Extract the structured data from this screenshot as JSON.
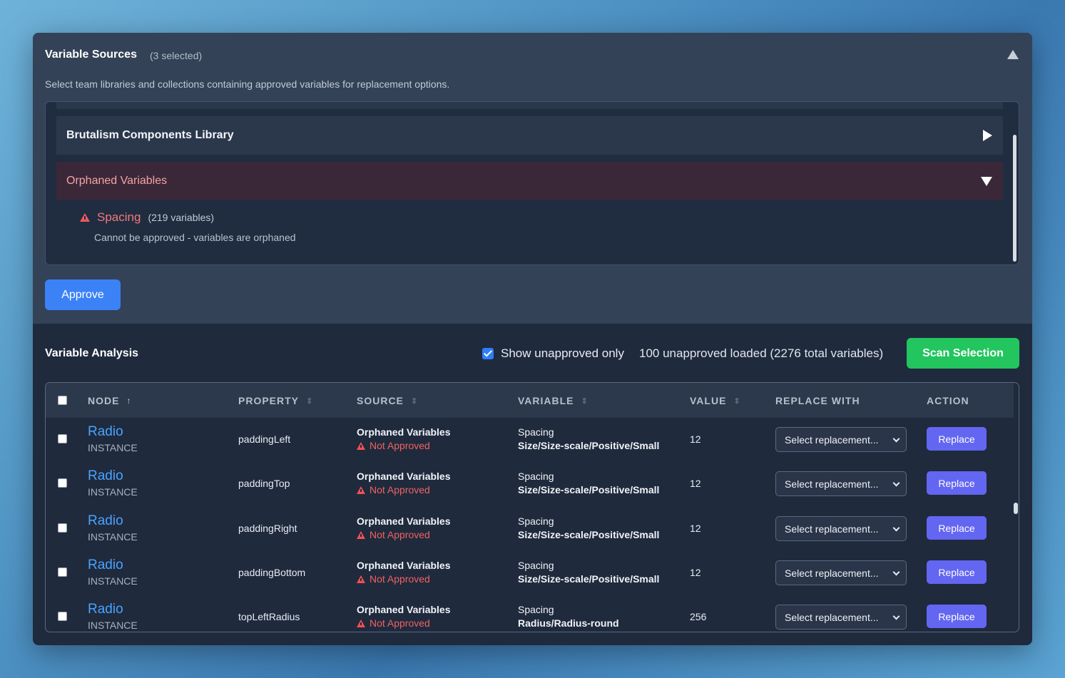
{
  "sources": {
    "title": "Variable Sources",
    "selected_count": "(3 selected)",
    "description": "Select team libraries and collections containing approved variables for replacement options.",
    "libraries": [
      {
        "name": "Brutalism Components Library",
        "expanded": false
      },
      {
        "name": "Orphaned Variables",
        "expanded": true
      }
    ],
    "orphan_item": {
      "name": "Spacing",
      "count": "(219 variables)",
      "note": "Cannot be approved - variables are orphaned"
    },
    "approve_label": "Approve"
  },
  "analysis": {
    "title": "Variable Analysis",
    "show_unapproved_label": "Show unapproved only",
    "show_unapproved_checked": true,
    "loaded_label": "100 unapproved loaded (2276 total variables)",
    "scan_label": "Scan Selection"
  },
  "table": {
    "columns": {
      "node": "NODE",
      "property": "PROPERTY",
      "source": "SOURCE",
      "variable": "VARIABLE",
      "value": "VALUE",
      "replace_with": "REPLACE WITH",
      "action": "ACTION"
    },
    "rows": [
      {
        "node": "Radio",
        "type": "INSTANCE",
        "property": "paddingLeft",
        "source": "Orphaned Variables",
        "status": "Not Approved",
        "collection": "Spacing",
        "path": "Size/Size-scale/Positive/Small",
        "value": "12",
        "select": "Select replacement...",
        "action": "Replace"
      },
      {
        "node": "Radio",
        "type": "INSTANCE",
        "property": "paddingTop",
        "source": "Orphaned Variables",
        "status": "Not Approved",
        "collection": "Spacing",
        "path": "Size/Size-scale/Positive/Small",
        "value": "12",
        "select": "Select replacement...",
        "action": "Replace"
      },
      {
        "node": "Radio",
        "type": "INSTANCE",
        "property": "paddingRight",
        "source": "Orphaned Variables",
        "status": "Not Approved",
        "collection": "Spacing",
        "path": "Size/Size-scale/Positive/Small",
        "value": "12",
        "select": "Select replacement...",
        "action": "Replace"
      },
      {
        "node": "Radio",
        "type": "INSTANCE",
        "property": "paddingBottom",
        "source": "Orphaned Variables",
        "status": "Not Approved",
        "collection": "Spacing",
        "path": "Size/Size-scale/Positive/Small",
        "value": "12",
        "select": "Select replacement...",
        "action": "Replace"
      },
      {
        "node": "Radio",
        "type": "INSTANCE",
        "property": "topLeftRadius",
        "source": "Orphaned Variables",
        "status": "Not Approved",
        "collection": "Spacing",
        "path": "Radius/Radius-round",
        "value": "256",
        "select": "Select replacement...",
        "action": "Replace"
      }
    ]
  },
  "colors": {
    "primary": "#3b82f6",
    "success": "#22c55e",
    "replace": "#6366f1",
    "danger": "#f06262",
    "link": "#4aa3ff"
  }
}
